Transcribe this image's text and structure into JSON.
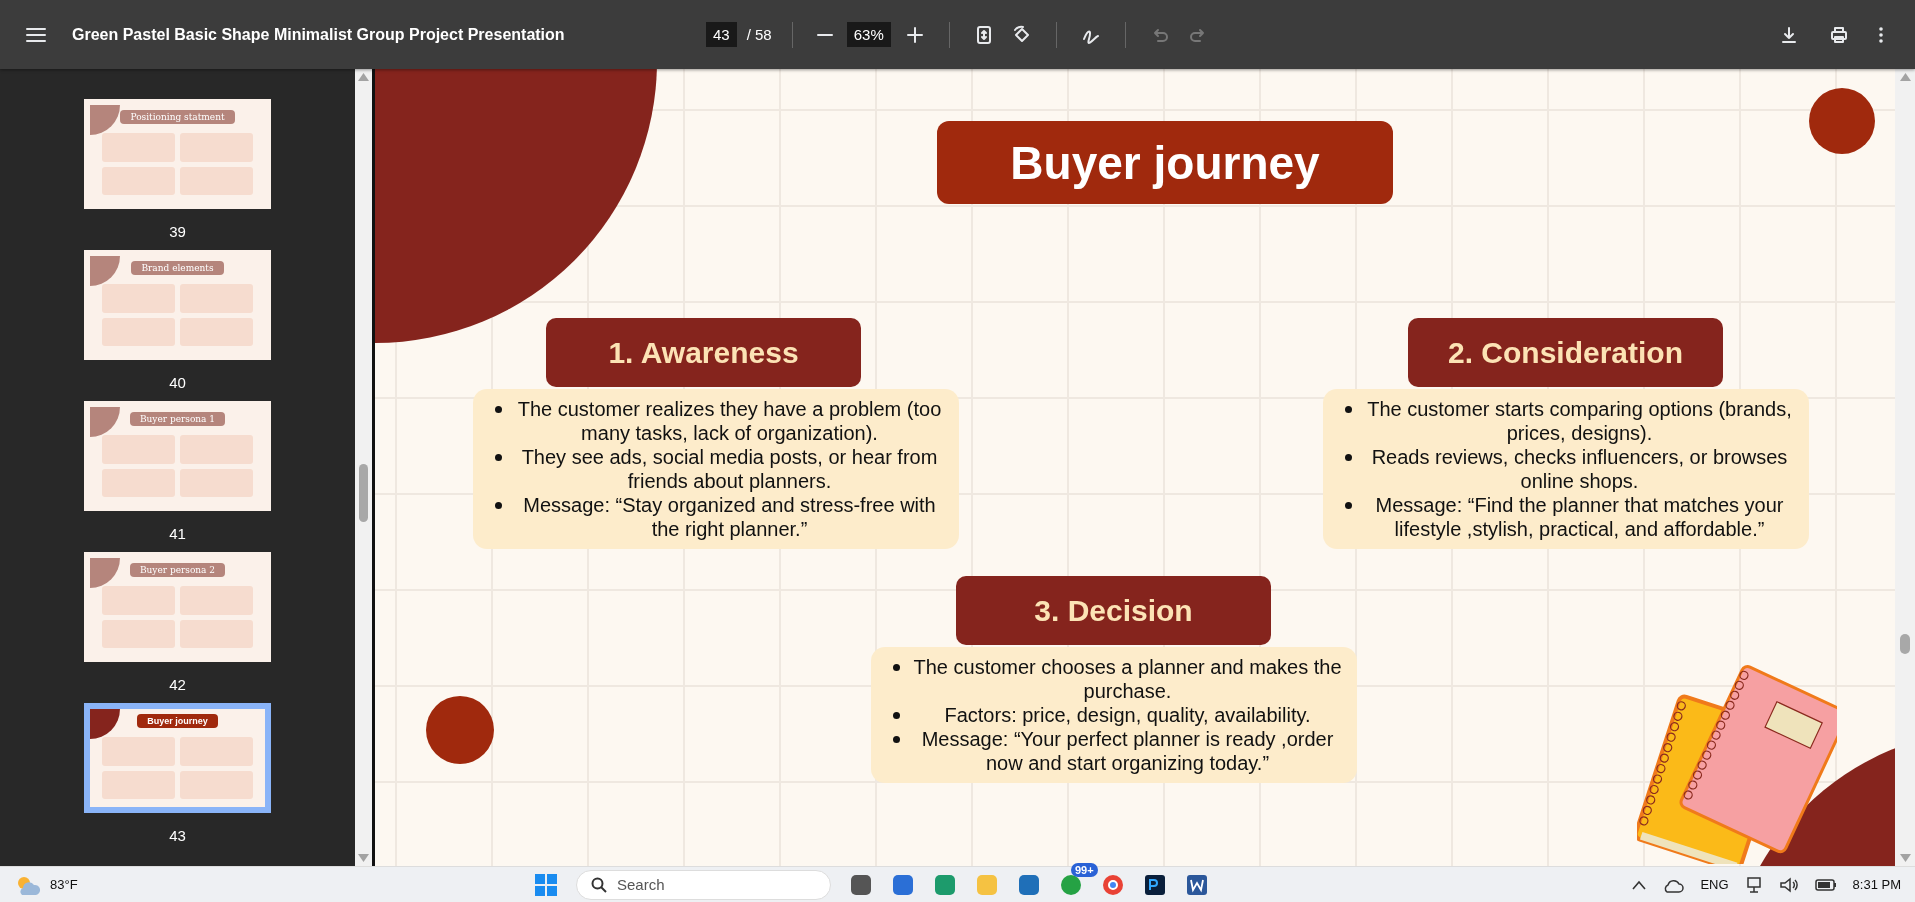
{
  "toolbar": {
    "title": "Green Pastel Basic Shape Minimalist Group Project Presentation",
    "page": "43",
    "page_total": "/ 58",
    "zoom": "63%",
    "undo_disabled": true,
    "redo_disabled": true
  },
  "thumbnails": [
    {
      "title": "Positioning statment",
      "page": "39",
      "selected": false
    },
    {
      "title": "Brand elements",
      "page": "40",
      "selected": false
    },
    {
      "title": "Buyer persona 1",
      "page": "41",
      "selected": false
    },
    {
      "title": "Buyer persona 2",
      "page": "42",
      "selected": false
    },
    {
      "title": "Buyer journey",
      "page": "43",
      "selected": true
    }
  ],
  "slide": {
    "title": "Buyer journey",
    "stages": [
      {
        "heading": "1. Awareness",
        "points": [
          "The customer realizes they have a problem (too many tasks, lack of organization).",
          "They see ads, social media posts, or hear from friends about planners.",
          "Message: “Stay organized and stress-free with the right planner.”"
        ]
      },
      {
        "heading": "2. Consideration",
        "points": [
          "The customer starts comparing options (brands, prices, designs).",
          "Reads reviews, checks influencers, or browses online shops.",
          "Message: “Find the planner that matches your lifestyle ,stylish, practical, and affordable.”"
        ]
      },
      {
        "heading": "3. Decision",
        "points": [
          "The customer chooses a planner and makes the purchase.",
          "Factors: price, design, quality, availability.",
          "Message: “Your perfect planner is ready ,order now and start organizing today.”"
        ]
      }
    ]
  },
  "taskbar": {
    "temperature": "83°F",
    "search_placeholder": "Search",
    "badge": "99+",
    "language": "ENG",
    "time": "8:31 PM"
  }
}
